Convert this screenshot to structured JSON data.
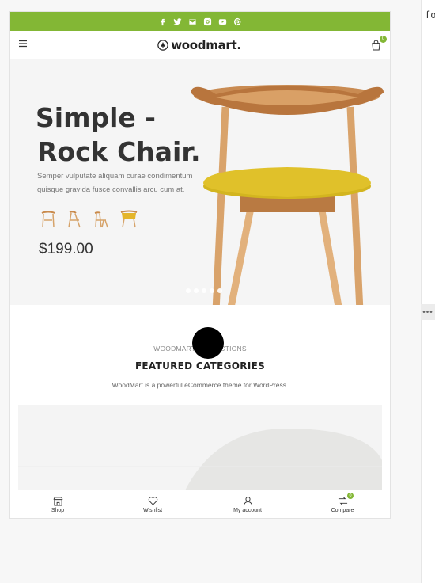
{
  "editor": {
    "code_text": "fo",
    "splitter_glyph": "•••"
  },
  "topbar": {
    "color": "#83b735",
    "social_icons": [
      "facebook-icon",
      "twitter-icon",
      "email-icon",
      "instagram-icon",
      "youtube-icon",
      "pinterest-icon"
    ]
  },
  "header": {
    "logo_text": "woodmart.",
    "cart_count": "0"
  },
  "hero": {
    "title_line1": "Simple -",
    "title_line2": "Rock Chair.",
    "description": "Semper vulputate aliquam curae condimentum quisque gravida fusce convallis arcu cum at.",
    "price": "$199.00",
    "thumbnails": [
      "chair-thumb-1",
      "chair-thumb-2",
      "chair-thumb-3",
      "chair-thumb-4"
    ]
  },
  "featured": {
    "subtitle": "WOODMART COLLECTIONS",
    "title": "FEATURED CATEGORIES",
    "description": "WoodMart is a powerful eCommerce theme for WordPress."
  },
  "bottom_nav": {
    "items": [
      {
        "label": "Shop",
        "icon": "shop-icon"
      },
      {
        "label": "Wishlist",
        "icon": "heart-icon"
      },
      {
        "label": "My account",
        "icon": "user-icon"
      },
      {
        "label": "Compare",
        "icon": "compare-icon",
        "badge": "0"
      }
    ]
  }
}
